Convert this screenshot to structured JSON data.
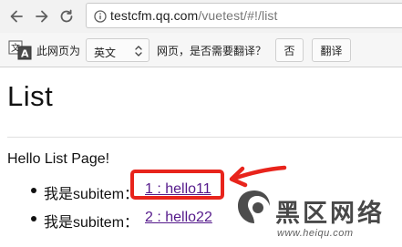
{
  "browser": {
    "url_host": "testcfm.qq.com",
    "url_path": "/vuetest/#!/list"
  },
  "translate_bar": {
    "prompt_prefix": "此网页为",
    "language": "英文",
    "prompt_suffix": "网页，是否需要翻译？",
    "no_button": "否",
    "translate_button": "翻译"
  },
  "page": {
    "title": "List",
    "intro": "Hello List Page!",
    "items": [
      {
        "label": "我是subitem：",
        "link": "1 : hello11"
      },
      {
        "label": "我是subitem：",
        "link": "2 : hello22"
      }
    ]
  },
  "annotation": {
    "color": "#e8241c"
  },
  "watermark": {
    "title": "黑区网络",
    "url": "www.heiqu.com"
  }
}
